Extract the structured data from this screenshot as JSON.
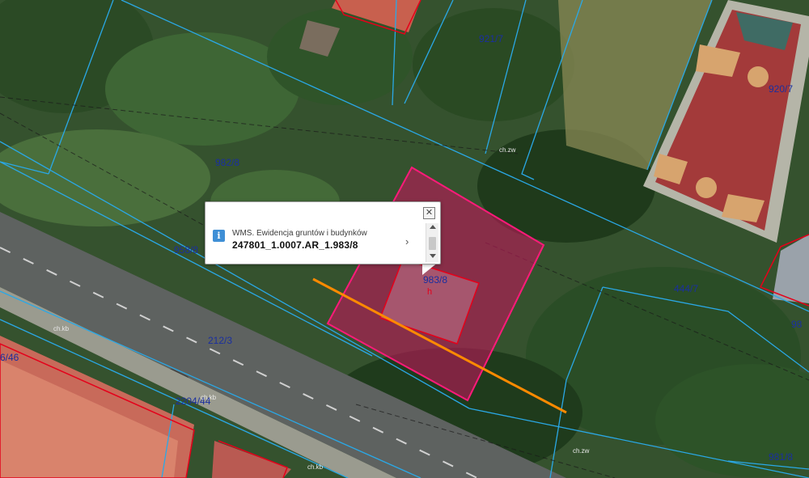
{
  "map": {
    "parcel_labels": {
      "p1": "921/7",
      "p2": "920/7",
      "p3": "982/8",
      "p4": "958/8",
      "p5": "983/8",
      "p6": "444/7",
      "p7": "212/3",
      "p8": "2204/44",
      "p9": "6/46",
      "p10": "981/8",
      "p11": "98"
    },
    "building_marker": "h",
    "small_labels": {
      "s1": "ch.kb",
      "s2": "ch.kb",
      "s3": "ch.zw",
      "s4": "ch.zw",
      "s5": "ch.kb"
    },
    "colors": {
      "parcel_boundary": "#2aa8e6",
      "highlight_fill": "#c0185a",
      "highlight_border": "#ff1a7a",
      "building_outline": "#e5001a",
      "measure_line": "#ff8a00",
      "parcel_label": "#1a2fa0"
    }
  },
  "popup": {
    "close_label": "✕",
    "info_icon": "i",
    "layer_name": "WMS. Ewidencja gruntów i budynków",
    "feature_id": "247801_1.0007.AR_1.983/8",
    "next_label": "›"
  }
}
